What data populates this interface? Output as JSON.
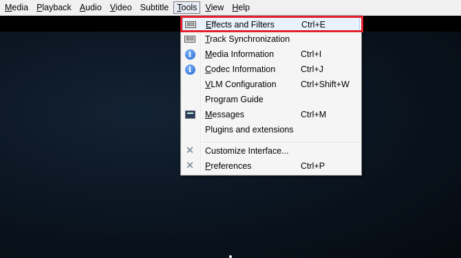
{
  "menubar": {
    "items": [
      {
        "label": "Media",
        "ul": "M",
        "rest": "edia"
      },
      {
        "label": "Playback",
        "ul": "P",
        "rest": "layback"
      },
      {
        "label": "Audio",
        "ul": "A",
        "rest": "udio"
      },
      {
        "label": "Video",
        "ul": "V",
        "rest": "ideo"
      },
      {
        "label": "Subtitle",
        "ul": "",
        "rest": "Subtitle"
      },
      {
        "label": "Tools",
        "ul": "T",
        "rest": "ools"
      },
      {
        "label": "View",
        "ul": "V",
        "rest": "iew"
      },
      {
        "label": "Help",
        "ul": "H",
        "rest": "elp"
      }
    ]
  },
  "tools_menu": {
    "items": [
      {
        "label": "Effects and Filters",
        "ul": "E",
        "rest": "ffects and Filters",
        "shortcut": "Ctrl+E",
        "icon": "equalizer-icon"
      },
      {
        "label": "Track Synchronization",
        "ul": "T",
        "rest": "rack Synchronization",
        "shortcut": "",
        "icon": "equalizer-icon"
      },
      {
        "label": "Media Information",
        "ul": "M",
        "rest": "edia Information",
        "shortcut": "Ctrl+I",
        "icon": "info-icon"
      },
      {
        "label": "Codec Information",
        "ul": "C",
        "rest": "odec Information",
        "shortcut": "Ctrl+J",
        "icon": "info-icon"
      },
      {
        "label": "VLM Configuration",
        "ul": "V",
        "rest": "LM Configuration",
        "shortcut": "Ctrl+Shift+W",
        "icon": ""
      },
      {
        "label": "Program Guide",
        "ul": "",
        "rest": "Program Guide",
        "shortcut": "",
        "icon": ""
      },
      {
        "label": "Messages",
        "ul": "M",
        "rest": "essages",
        "shortcut": "Ctrl+M",
        "icon": "terminal-icon"
      },
      {
        "label": "Plugins and extensions",
        "ul": "",
        "rest": "Plugins and extensions",
        "shortcut": "",
        "icon": ""
      },
      {
        "label": "Customize Interface...",
        "ul": "",
        "rest": "Customize Interface...",
        "shortcut": "",
        "icon": "tools-icon"
      },
      {
        "label": "Preferences",
        "ul": "P",
        "rest": "references",
        "shortcut": "Ctrl+P",
        "icon": "tools-icon"
      }
    ]
  },
  "colors": {
    "highlight_border": "#e3202b",
    "menu_bg": "#f5f5f5"
  }
}
